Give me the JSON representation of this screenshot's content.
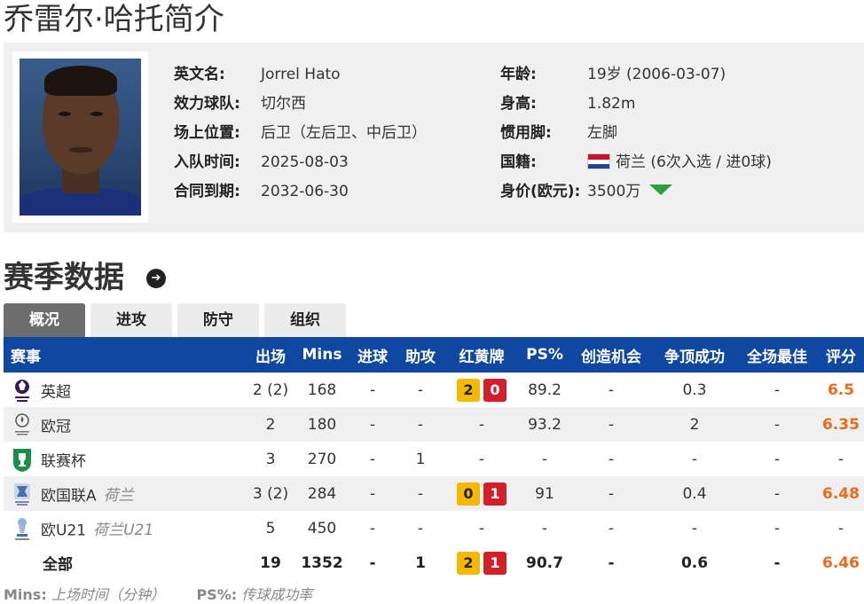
{
  "page_title": "乔雷尔·哈托简介",
  "profile": {
    "english_name_label": "英文名:",
    "english_name": "Jorrel Hato",
    "club_label": "效力球队:",
    "club": "切尔西",
    "position_label": "场上位置:",
    "position": "后卫（左后卫、中后卫）",
    "join_label": "入队时间:",
    "join_date": "2025-08-03",
    "contract_label": "合同到期:",
    "contract_end": "2032-06-30",
    "age_label": "年龄:",
    "age": "19岁  (2006-03-07)",
    "height_label": "身高:",
    "height": "1.82m",
    "foot_label": "惯用脚:",
    "foot": "左脚",
    "nationality_label": "国籍:",
    "nationality": "荷兰 (6次入选 / 进0球)",
    "value_label": "身价(欧元):",
    "value": "3500万",
    "value_trend": "down",
    "trend_color": "#2e9e3e"
  },
  "section_title": "赛季数据",
  "tabs": [
    {
      "label": "概况",
      "active": true
    },
    {
      "label": "进攻",
      "active": false
    },
    {
      "label": "防守",
      "active": false
    },
    {
      "label": "组织",
      "active": false
    }
  ],
  "table": {
    "headers": [
      "赛事",
      "出场",
      "Mins",
      "进球",
      "助攻",
      "红黄牌",
      "PS%",
      "创造机会",
      "争顶成功",
      "全场最佳",
      "评分"
    ],
    "rows": [
      {
        "competition": "英超",
        "team": "",
        "icon": "premier-league-icon",
        "apps": "2 (2)",
        "mins": "168",
        "goals": "-",
        "assists": "-",
        "yellow": "2",
        "red": "0",
        "ps": "89.2",
        "chances": "-",
        "aerials": "0.3",
        "motm": "-",
        "rating": "6.5"
      },
      {
        "competition": "欧冠",
        "team": "",
        "icon": "champions-league-icon",
        "apps": "2",
        "mins": "180",
        "goals": "-",
        "assists": "-",
        "yellow": "",
        "red": "",
        "ps": "93.2",
        "chances": "-",
        "aerials": "2",
        "motm": "-",
        "rating": "6.35"
      },
      {
        "competition": "联赛杯",
        "team": "",
        "icon": "league-cup-icon",
        "apps": "3",
        "mins": "270",
        "goals": "-",
        "assists": "1",
        "yellow": "",
        "red": "",
        "ps": "-",
        "chances": "-",
        "aerials": "-",
        "motm": "-",
        "rating": "-"
      },
      {
        "competition": "欧国联A",
        "team": "荷兰",
        "icon": "nations-league-icon",
        "apps": "3 (2)",
        "mins": "284",
        "goals": "-",
        "assists": "-",
        "yellow": "0",
        "red": "1",
        "ps": "91",
        "chances": "-",
        "aerials": "0.4",
        "motm": "-",
        "rating": "6.48"
      },
      {
        "competition": "欧U21",
        "team": "荷兰U21",
        "icon": "euro-u21-icon",
        "apps": "5",
        "mins": "450",
        "goals": "-",
        "assists": "-",
        "yellow": "",
        "red": "",
        "ps": "-",
        "chances": "-",
        "aerials": "-",
        "motm": "-",
        "rating": "-"
      }
    ],
    "total": {
      "competition": "全部",
      "apps": "19",
      "mins": "1352",
      "goals": "-",
      "assists": "1",
      "yellow": "2",
      "red": "1",
      "ps": "90.7",
      "chances": "-",
      "aerials": "0.6",
      "motm": "-",
      "rating": "6.46"
    }
  },
  "legend": {
    "mins_key": "Mins:",
    "mins_desc": "上场时间（分钟）",
    "ps_key": "PS%:",
    "ps_desc": "传球成功率"
  },
  "colors": {
    "header_bg": "#0f47a1",
    "rating": "#e86a1a",
    "yellow_card": "#f5b800",
    "red_card": "#d2202a"
  }
}
